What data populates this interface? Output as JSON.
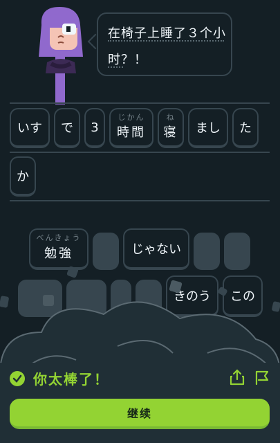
{
  "prompt": {
    "line1": "在椅子上睡了３个小",
    "line2": "时？！"
  },
  "answer_tiles": [
    {
      "label": "いす",
      "ruby": ""
    },
    {
      "label": "で",
      "ruby": ""
    },
    {
      "label": "3",
      "ruby": ""
    },
    {
      "label": "時間",
      "ruby": "じかん"
    },
    {
      "label": "寝",
      "ruby": "ね"
    },
    {
      "label": "まし",
      "ruby": ""
    },
    {
      "label": "た",
      "ruby": ""
    },
    {
      "label": "か",
      "ruby": ""
    }
  ],
  "bank_tiles": [
    {
      "label": "勉強",
      "ruby": "べんきょう"
    },
    {
      "label": "じゃない",
      "ruby": ""
    },
    {
      "label": "きのう",
      "ruby": ""
    },
    {
      "label": "この",
      "ruby": ""
    }
  ],
  "feedback": {
    "title": "你太棒了！",
    "continue_label": "继续",
    "status_color": "#93d333"
  },
  "icons": [
    "check-icon",
    "share-icon",
    "report-flag-icon"
  ]
}
